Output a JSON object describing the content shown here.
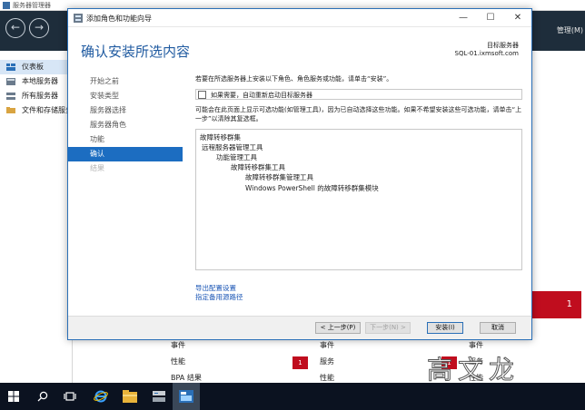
{
  "background_window": {
    "title": "服务器管理器",
    "menu_manage": "管理(M)",
    "sidebar": [
      {
        "label": "仪表板",
        "active": true
      },
      {
        "label": "本地服务器",
        "active": false
      },
      {
        "label": "所有服务器",
        "active": false
      },
      {
        "label": "文件和存储服务",
        "active": false
      }
    ],
    "red_tile_count": "1",
    "tile_columns": [
      {
        "rows": [
          {
            "label": "事件",
            "badge": ""
          },
          {
            "label": "性能",
            "badge": ""
          },
          {
            "label": "BPA 结果",
            "badge": ""
          }
        ]
      },
      {
        "rows": [
          {
            "label": "事件",
            "badge": ""
          },
          {
            "label": "服务",
            "badge": "1"
          },
          {
            "label": "性能",
            "badge": ""
          }
        ]
      },
      {
        "rows": [
          {
            "label": "事件",
            "badge": ""
          },
          {
            "label": "服务",
            "badge": "1"
          },
          {
            "label": "性能",
            "badge": ""
          }
        ]
      }
    ]
  },
  "watermark": "高文龙",
  "dialog": {
    "title": "添加角色和功能向导",
    "heading": "确认安装所选内容",
    "target_label": "目标服务器",
    "target_value": "SQL-01.ixmsoft.com",
    "steps": [
      {
        "label": "开始之前",
        "state": "normal"
      },
      {
        "label": "安装类型",
        "state": "normal"
      },
      {
        "label": "服务器选择",
        "state": "normal"
      },
      {
        "label": "服务器角色",
        "state": "normal"
      },
      {
        "label": "功能",
        "state": "normal"
      },
      {
        "label": "确认",
        "state": "active"
      },
      {
        "label": "结果",
        "state": "disabled"
      }
    ],
    "intro": "若要在所选服务器上安装以下角色、角色服务或功能，请单击“安装”。",
    "restart_label": "如果需要，自动重新启动目标服务器",
    "note": "可能会在此页面上显示可选功能(如管理工具)，因为已自动选择这些功能。如果不希望安装这些可选功能，请单击“上一步”以清除其复选框。",
    "features": [
      {
        "text": "故障转移群集",
        "level": 0
      },
      {
        "text": "远程服务器管理工具",
        "level": 1
      },
      {
        "text": "功能管理工具",
        "level": 2
      },
      {
        "text": "故障转移群集工具",
        "level": 3
      },
      {
        "text": "故障转移群集管理工具",
        "level": 4
      },
      {
        "text": "Windows PowerShell 的故障转移群集模块",
        "level": 5
      }
    ],
    "link_export": "导出配置设置",
    "link_source": "指定备用源路径",
    "btn_prev": "< 上一步(P)",
    "btn_next": "下一步(N) >",
    "btn_install": "安装(I)",
    "btn_cancel": "取消"
  },
  "colors": {
    "accent": "#1c6dc1",
    "heading": "#1f5aa0",
    "alert": "#c00d1e",
    "header_bg": "#1e2d3b"
  },
  "icons": {
    "taskbar": [
      "windows-start-icon",
      "search-icon",
      "task-view-icon",
      "internet-explorer-icon",
      "file-explorer-icon",
      "server-manager-icon",
      "powershell-icon"
    ]
  }
}
